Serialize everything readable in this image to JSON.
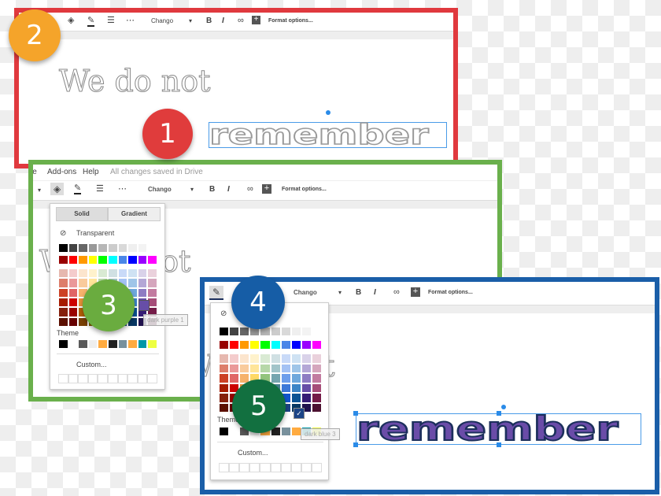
{
  "toolbar": {
    "font": "Chango",
    "bold": "B",
    "italic": "I",
    "link_icon": "link-icon",
    "comment_icon": "add-comment-icon",
    "format_options": "Format options...",
    "caret": "▾"
  },
  "menu": {
    "items": [
      "le",
      "Add-ons",
      "Help"
    ],
    "status": "All changes saved in Drive"
  },
  "doc": {
    "line1": "We do not",
    "line2": "remember"
  },
  "fill_menu": {
    "tab_solid": "Solid",
    "tab_gradient": "Gradient",
    "transparent": "Transparent",
    "theme": "Theme",
    "custom": "Custom...",
    "tooltip": "dark purple 1"
  },
  "border_menu": {
    "theme": "Theme",
    "custom": "Custom...",
    "tooltip": "dark blue 3"
  },
  "steps": [
    {
      "label": "1",
      "color": "#e03c3c"
    },
    {
      "label": "2",
      "color": "#f5a42a"
    },
    {
      "label": "3",
      "color": "#6aac3f"
    },
    {
      "label": "4",
      "color": "#165da6"
    },
    {
      "label": "5",
      "color": "#127040"
    }
  ],
  "frame_colors": {
    "red": "#e0393e",
    "green": "#6ab04c",
    "blue": "#1a5ea8"
  },
  "text_colors": {
    "fill": "#6a4ca8",
    "stroke": "#1c2f5c"
  },
  "palette": {
    "grays": [
      "#000000",
      "#434343",
      "#666666",
      "#999999",
      "#b7b7b7",
      "#cccccc",
      "#d9d9d9",
      "#efefef",
      "#f3f3f3",
      "#ffffff"
    ],
    "main": [
      "#980000",
      "#ff0000",
      "#ff9900",
      "#ffff00",
      "#00ff00",
      "#00ffff",
      "#4a86e8",
      "#0000ff",
      "#9900ff",
      "#ff00ff"
    ],
    "shades": [
      [
        "#e6b8af",
        "#f4cccc",
        "#fce5cd",
        "#fff2cc",
        "#d9ead3",
        "#d0e0e3",
        "#c9daf8",
        "#cfe2f3",
        "#d9d2e9",
        "#ead1dc"
      ],
      [
        "#dd7e6b",
        "#ea9999",
        "#f9cb9c",
        "#ffe599",
        "#b6d7a8",
        "#a2c4c9",
        "#a4c2f4",
        "#9fc5e8",
        "#b4a7d6",
        "#d5a6bd"
      ],
      [
        "#cc4125",
        "#e06666",
        "#f6b26b",
        "#ffd966",
        "#93c47d",
        "#76a5af",
        "#6d9eeb",
        "#6fa8dc",
        "#8e7cc3",
        "#c27ba0"
      ],
      [
        "#a61c00",
        "#cc0000",
        "#e69138",
        "#f1c232",
        "#6aa84f",
        "#45818e",
        "#3c78d8",
        "#3d85c6",
        "#674ea7",
        "#a64d79"
      ],
      [
        "#85200c",
        "#990000",
        "#b45f06",
        "#bf9000",
        "#38761d",
        "#134f5c",
        "#1155cc",
        "#0b5394",
        "#351c75",
        "#741b47"
      ],
      [
        "#5b0f00",
        "#660000",
        "#783f04",
        "#7f6000",
        "#274e13",
        "#0c343d",
        "#1c4587",
        "#073763",
        "#20124d",
        "#4c1130"
      ]
    ],
    "theme": [
      "#000000",
      "#ffffff",
      "#595959",
      "#eeeeee",
      "#ffab40",
      "#212121",
      "#78909c",
      "#ffab40",
      "#0097a7",
      "#eeff41"
    ]
  }
}
